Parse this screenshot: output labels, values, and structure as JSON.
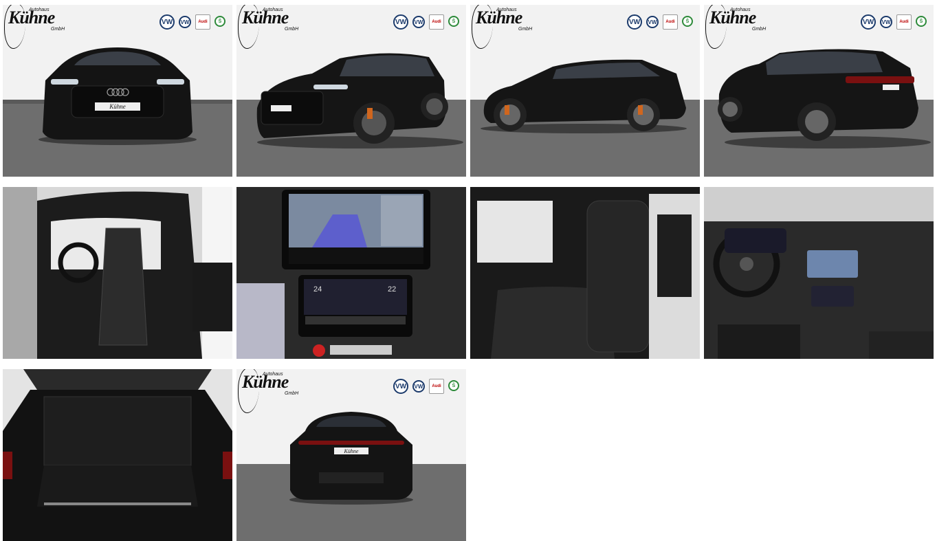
{
  "dealer": {
    "brand": "Kühne",
    "sub_top": "Autohaus",
    "sub_bottom": "GmbH"
  },
  "badges": {
    "vw": "VW",
    "vwn": "VW",
    "audi": "Audi",
    "skoda": "Š"
  },
  "gallery": {
    "photos": [
      {
        "view": "front"
      },
      {
        "view": "front-three-quarter"
      },
      {
        "view": "side"
      },
      {
        "view": "rear-three-quarter"
      },
      {
        "view": "interior-front-seat"
      },
      {
        "view": "center-console-screens"
      },
      {
        "view": "rear-seats"
      },
      {
        "view": "dashboard"
      },
      {
        "view": "trunk"
      },
      {
        "view": "rear"
      }
    ],
    "plate_text": "Kühne"
  }
}
